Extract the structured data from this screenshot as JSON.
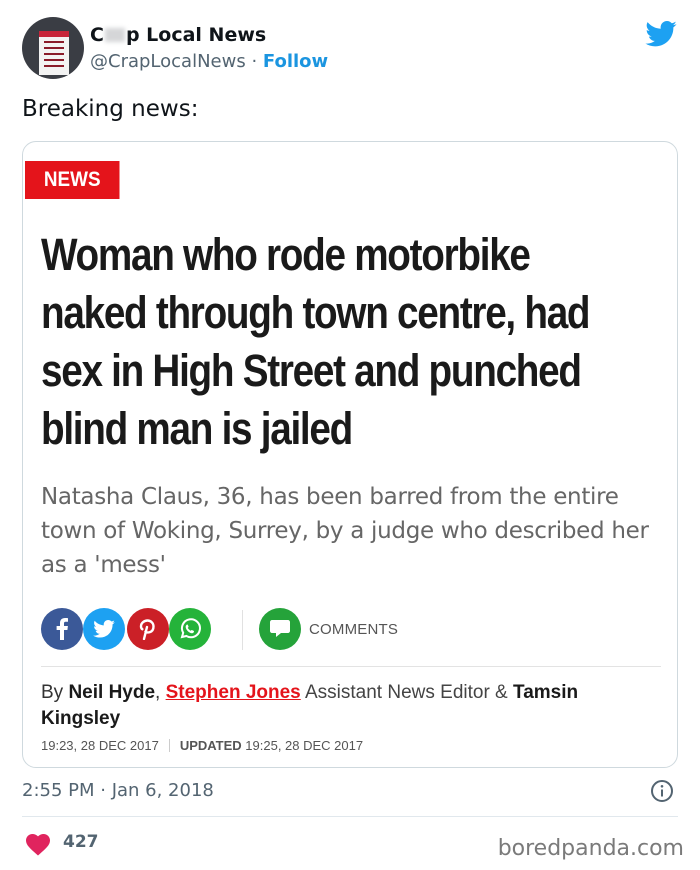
{
  "tweet": {
    "user_name_start": "C",
    "user_name_end": "p Local News",
    "handle": "@CrapLocalNews",
    "separator": " · ",
    "follow_label": "Follow",
    "text": "Breaking news:",
    "timestamp": "2:55 PM · Jan 6, 2018",
    "like_count": "427"
  },
  "article": {
    "tag": "NEWS",
    "headline": "Woman who rode motorbike naked through town centre, had sex in High Street and punched blind man is jailed",
    "standfirst": "Natasha Claus, 36, has been barred from the entire town of Woking, Surrey, by a judge who described her as a 'mess'",
    "comments_label": "COMMENTS",
    "byline_prefix": "By ",
    "author1": "Neil Hyde",
    "comma": ", ",
    "author2": "Stephen Jones",
    "role": " Assistant News Editor & ",
    "author3": "Tamsin Kingsley",
    "published": "19:23, 28 DEC 2017",
    "updated_label": "UPDATED",
    "updated": " 19:25, 28 DEC 2017"
  },
  "watermark": "boredpanda.com",
  "colors": {
    "accent_blue": "#1b95e0",
    "news_red": "#e4141b",
    "like_red": "#e0245e"
  }
}
